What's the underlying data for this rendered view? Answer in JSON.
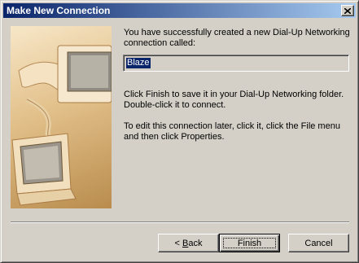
{
  "window": {
    "title": "Make New Connection",
    "close_icon": "close-icon"
  },
  "picture": {
    "icon": "computer-phone-illustration"
  },
  "content": {
    "intro_text": "You have successfully created a new Dial-Up Networking connection called:",
    "connection_name": "Blaze",
    "finish_text": "Click Finish to save it in your Dial-Up Networking folder. Double-click it to connect.",
    "edit_text": "To edit this connection later, click it, click the File menu and then click Properties."
  },
  "buttons": {
    "back_prefix": "< ",
    "back_accel": "B",
    "back_rest": "ack",
    "finish": "Finish",
    "cancel": "Cancel"
  },
  "colors": {
    "titlebar_start": "#0a246a",
    "titlebar_end": "#a6caf0",
    "dialog_face": "#d4d0c8",
    "selection": "#0a246a",
    "picture_tone": "#c79a5a"
  }
}
